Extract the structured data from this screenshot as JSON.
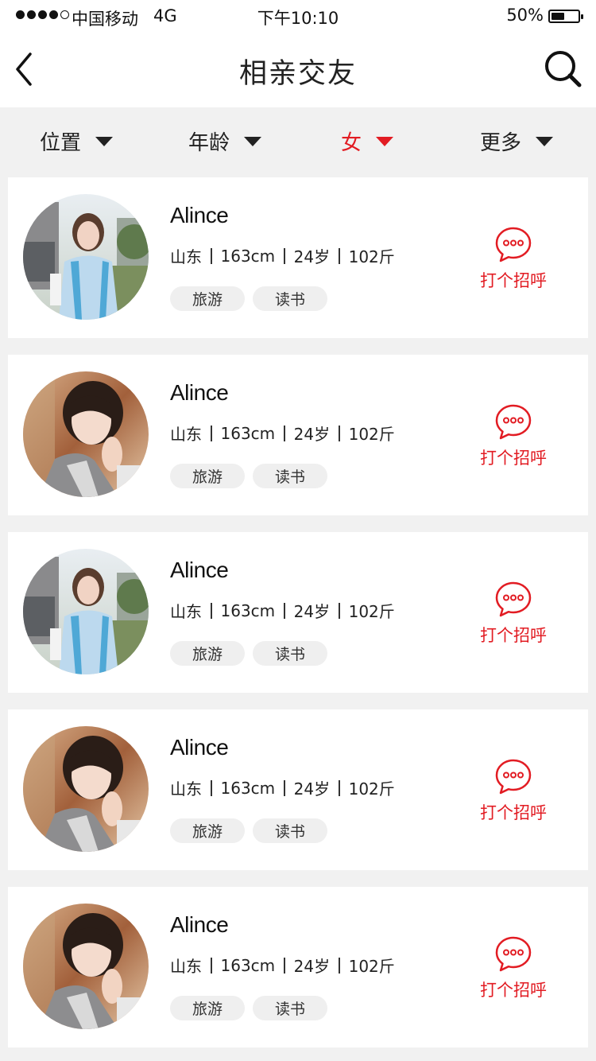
{
  "status_bar": {
    "carrier": "中国移动",
    "network": "4G",
    "time": "下午10:10",
    "battery": "50%",
    "battery_level": 0.5
  },
  "nav": {
    "title": "相亲交友",
    "back_icon": "chevron-left-icon",
    "search_icon": "search-icon"
  },
  "filters": [
    {
      "label": "位置",
      "active": false
    },
    {
      "label": "年龄",
      "active": false
    },
    {
      "label": "女",
      "active": true
    },
    {
      "label": "更多",
      "active": false
    }
  ],
  "colors": {
    "accent": "#e21c23",
    "background": "#f1f1f1",
    "card": "#ffffff",
    "tag_bg": "#efefef"
  },
  "profiles": [
    {
      "name": "Alince",
      "region": "山东",
      "height": "163cm",
      "age": "24岁",
      "weight": "102斤",
      "tags": [
        "旅游",
        "读书"
      ],
      "greet_label": "打个招呼",
      "avatar": "avatar-1"
    },
    {
      "name": "Alince",
      "region": "山东",
      "height": "163cm",
      "age": "24岁",
      "weight": "102斤",
      "tags": [
        "旅游",
        "读书"
      ],
      "greet_label": "打个招呼",
      "avatar": "avatar-2"
    },
    {
      "name": "Alince",
      "region": "山东",
      "height": "163cm",
      "age": "24岁",
      "weight": "102斤",
      "tags": [
        "旅游",
        "读书"
      ],
      "greet_label": "打个招呼",
      "avatar": "avatar-1"
    },
    {
      "name": "Alince",
      "region": "山东",
      "height": "163cm",
      "age": "24岁",
      "weight": "102斤",
      "tags": [
        "旅游",
        "读书"
      ],
      "greet_label": "打个招呼",
      "avatar": "avatar-2"
    },
    {
      "name": "Alince",
      "region": "山东",
      "height": "163cm",
      "age": "24岁",
      "weight": "102斤",
      "tags": [
        "旅游",
        "读书"
      ],
      "greet_label": "打个招呼",
      "avatar": "avatar-2"
    }
  ]
}
